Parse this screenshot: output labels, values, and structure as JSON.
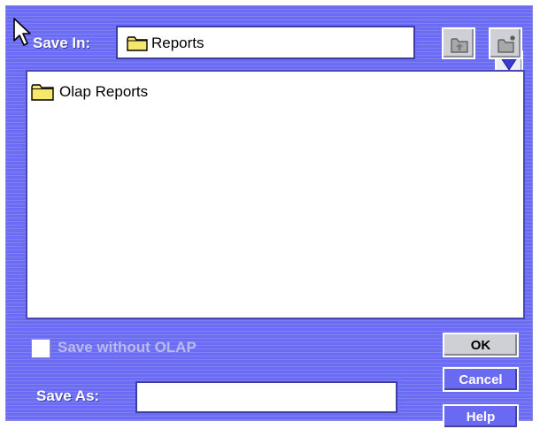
{
  "dialog": {
    "save_in_label": "Save In:",
    "location": {
      "value": "Reports",
      "icon": "folder-icon"
    },
    "toolbar": {
      "dropdown_icon": "chevron-down-icon",
      "up_folder_icon": "up-folder-icon",
      "new_folder_icon": "new-folder-icon"
    },
    "file_list": {
      "items": [
        {
          "label": "Olap Reports",
          "icon": "folder-icon"
        }
      ]
    },
    "options": {
      "save_without_olap_label": "Save without OLAP",
      "checked": false
    },
    "save_as": {
      "label": "Save As:",
      "value": ""
    },
    "buttons": {
      "ok": "OK",
      "cancel": "Cancel",
      "help": "Help"
    }
  },
  "colors": {
    "dialog_background": "#6b6cf4",
    "panel_white": "#ffffff",
    "button_gray": "#cfcfd6",
    "disabled_text": "#b9b9ea"
  }
}
